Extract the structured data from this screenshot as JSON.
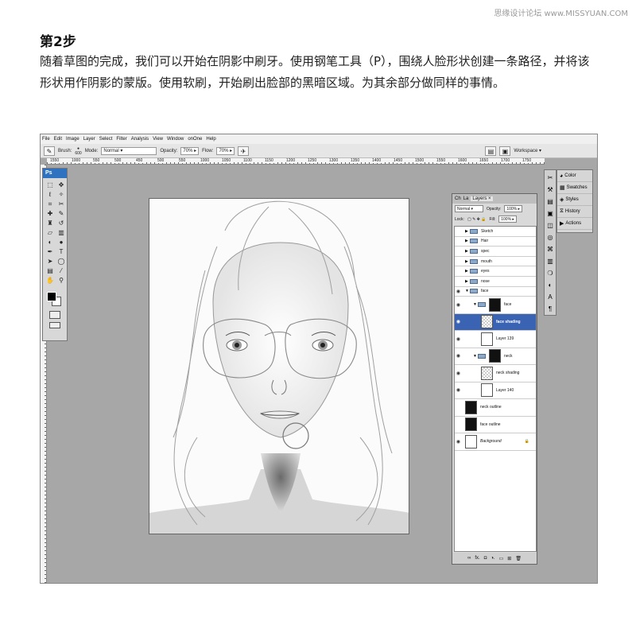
{
  "watermark": "思缘设计论坛 www.MISSYUAN.COM",
  "tutorial": {
    "step_title": "第2步",
    "step_body": "随着草图的完成，我们可以开始在阴影中刷牙。使用钢笔工具（P），围绕人脸形状创建一条路径，并将该形状用作阴影的蒙版。使用软刷，开始刷出脸部的黑暗区域。为其余部分做同样的事情。"
  },
  "menubar": [
    "File",
    "Edit",
    "Image",
    "Layer",
    "Select",
    "Filter",
    "Analysis",
    "View",
    "Window",
    "onOne",
    "Help"
  ],
  "options_bar": {
    "brush_label": "Brush:",
    "brush_size": "600",
    "mode_label": "Mode:",
    "mode_value": "Normal",
    "opacity_label": "Opacity:",
    "opacity_value": "70%",
    "flow_label": "Flow:",
    "flow_value": "70%",
    "workspace_label": "Workspace ▾"
  },
  "ruler_ticks": [
    "1550",
    "1000",
    "550",
    "500",
    "450",
    "500",
    "550",
    "1000",
    "1050",
    "1100",
    "1150",
    "1200",
    "1250",
    "1300",
    "1350",
    "1400",
    "1450",
    "1500",
    "1550",
    "1600",
    "1650",
    "1700",
    "1750"
  ],
  "toolbox": {
    "logo": "Ps",
    "tools": [
      {
        "icon": "marquee-icon",
        "glyph": "⬚"
      },
      {
        "icon": "move-icon",
        "glyph": "✥"
      },
      {
        "icon": "lasso-icon",
        "glyph": "ℓ"
      },
      {
        "icon": "magic-wand-icon",
        "glyph": "✧"
      },
      {
        "icon": "crop-icon",
        "glyph": "⌗"
      },
      {
        "icon": "slice-icon",
        "glyph": "✂"
      },
      {
        "icon": "healing-icon",
        "glyph": "✚"
      },
      {
        "icon": "brush-icon",
        "glyph": "✎"
      },
      {
        "icon": "stamp-icon",
        "glyph": "♜"
      },
      {
        "icon": "history-brush-icon",
        "glyph": "↺"
      },
      {
        "icon": "eraser-icon",
        "glyph": "▱"
      },
      {
        "icon": "gradient-icon",
        "glyph": "▥"
      },
      {
        "icon": "blur-icon",
        "glyph": "◐"
      },
      {
        "icon": "dodge-icon",
        "glyph": "●"
      },
      {
        "icon": "pen-icon",
        "glyph": "✒"
      },
      {
        "icon": "type-icon",
        "glyph": "T"
      },
      {
        "icon": "path-select-icon",
        "glyph": "➤"
      },
      {
        "icon": "shape-icon",
        "glyph": "◯"
      },
      {
        "icon": "notes-icon",
        "glyph": "▤"
      },
      {
        "icon": "eyedropper-icon",
        "glyph": "⁄"
      },
      {
        "icon": "hand-icon",
        "glyph": "✋"
      },
      {
        "icon": "zoom-icon",
        "glyph": "⚲"
      }
    ]
  },
  "layers_panel": {
    "tabs": [
      "Ch",
      "La",
      "Layers ×"
    ],
    "blend_mode": "Normal",
    "opacity_label": "Opacity:",
    "opacity_value": "100%",
    "lock_label": "Lock:",
    "fill_label": "Fill:",
    "fill_value": "100%",
    "layers": [
      {
        "name": "Sketch",
        "kind": "group",
        "indent": 0,
        "visible": false,
        "selected": false
      },
      {
        "name": "Hair",
        "kind": "group",
        "indent": 0,
        "visible": false,
        "selected": false
      },
      {
        "name": "spec",
        "kind": "group",
        "indent": 0,
        "visible": false,
        "selected": false
      },
      {
        "name": "mouth",
        "kind": "group",
        "indent": 0,
        "visible": false,
        "selected": false
      },
      {
        "name": "eyes",
        "kind": "group",
        "indent": 0,
        "visible": false,
        "selected": false
      },
      {
        "name": "nose",
        "kind": "group",
        "indent": 0,
        "visible": false,
        "selected": false
      },
      {
        "name": "face",
        "kind": "group-open",
        "indent": 0,
        "visible": true,
        "selected": false
      },
      {
        "name": "face",
        "kind": "group-mask",
        "indent": 1,
        "visible": true,
        "selected": false
      },
      {
        "name": "face shading",
        "kind": "layer-checker",
        "indent": 2,
        "visible": true,
        "selected": true
      },
      {
        "name": "Layer 139",
        "kind": "layer-white",
        "indent": 2,
        "visible": true,
        "selected": false
      },
      {
        "name": "neck",
        "kind": "group-mask",
        "indent": 1,
        "visible": true,
        "selected": false
      },
      {
        "name": "neck shading",
        "kind": "layer-checker",
        "indent": 2,
        "visible": true,
        "selected": false
      },
      {
        "name": "Layer 140",
        "kind": "layer-white",
        "indent": 2,
        "visible": true,
        "selected": false
      },
      {
        "name": "neck outline",
        "kind": "layer-mask",
        "indent": 0,
        "visible": false,
        "selected": false
      },
      {
        "name": "face outline",
        "kind": "layer-mask",
        "indent": 0,
        "visible": false,
        "selected": false
      },
      {
        "name": "Background",
        "kind": "background",
        "indent": 0,
        "visible": true,
        "selected": false
      }
    ],
    "bottom_icons": [
      "∞",
      "fx.",
      "◘",
      "◑.",
      "▭",
      "⊞",
      "🗑"
    ]
  },
  "dock": {
    "panels": [
      {
        "label": "Color",
        "icon": "color-icon",
        "glyph": "◕"
      },
      {
        "label": "Swatches",
        "icon": "swatches-icon",
        "glyph": "▦"
      },
      {
        "label": "Styles",
        "icon": "styles-icon",
        "glyph": "◈"
      },
      {
        "label": "History",
        "icon": "history-icon",
        "glyph": "⧖"
      },
      {
        "label": "Actions",
        "icon": "actions-icon",
        "glyph": "▶"
      }
    ],
    "icon_strip": [
      "✂",
      "⚒",
      "▤",
      "▣",
      "◫",
      "◎",
      "⌘",
      "▥",
      "❍",
      "◐",
      "A",
      "¶"
    ]
  }
}
